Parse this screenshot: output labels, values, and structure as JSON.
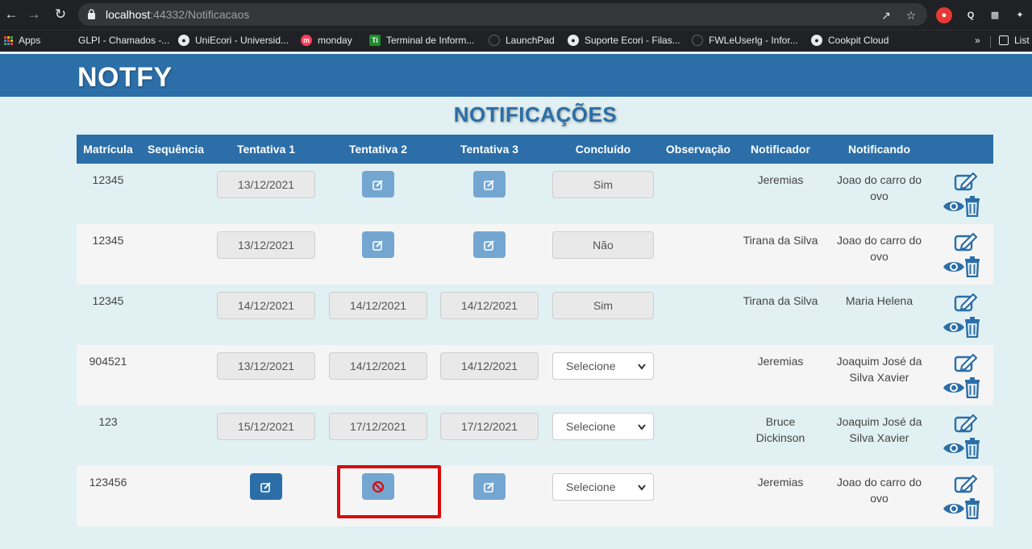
{
  "browser": {
    "url_host": "localhost",
    "url_rest": ":44332/Notificacaos",
    "bookmarks": [
      {
        "label": "Apps",
        "icon": "apps-grid-icon"
      },
      {
        "label": "GLPI - Chamados -...",
        "icon": "glpi-icon"
      },
      {
        "label": "UniEcori - Universid...",
        "icon": "globe-icon"
      },
      {
        "label": "monday",
        "icon": "monday-icon"
      },
      {
        "label": "Terminal de Inform...",
        "icon": "terminal-icon"
      },
      {
        "label": "LaunchPad",
        "icon": "launchpad-icon"
      },
      {
        "label": "Suporte Ecori - Filas...",
        "icon": "globe-icon"
      },
      {
        "label": "FWLeUserlg - Infor...",
        "icon": "fw-icon"
      },
      {
        "label": "Cookpit Cloud",
        "icon": "globe-icon"
      }
    ],
    "more_bookmarks": "»",
    "reading_list": "List"
  },
  "app": {
    "brand": "NOTFY",
    "page_title": "NOTIFICAÇÕES"
  },
  "table": {
    "headers": [
      "Matrícula",
      "Sequência",
      "Tentativa 1",
      "Tentativa 2",
      "Tentativa 3",
      "Concluído",
      "Observação",
      "Notificador",
      "Notificando"
    ],
    "rows": [
      {
        "matricula": "12345",
        "t1": "13/12/2021",
        "t2": null,
        "t3": null,
        "concluido": "Sim",
        "concluido_type": "text",
        "notificador": "Jeremias",
        "notificando": "Joao do carro do ovo"
      },
      {
        "matricula": "12345",
        "t1": "13/12/2021",
        "t2": null,
        "t3": null,
        "concluido": "Não",
        "concluido_type": "text",
        "notificador": "Tirana da Silva",
        "notificando": "Joao do carro do ovo"
      },
      {
        "matricula": "12345",
        "t1": "14/12/2021",
        "t2": "14/12/2021",
        "t3": "14/12/2021",
        "concluido": "Sim",
        "concluido_type": "text",
        "notificador": "Tirana da Silva",
        "notificando": "Maria Helena"
      },
      {
        "matricula": "904521",
        "t1": "13/12/2021",
        "t2": "14/12/2021",
        "t3": "14/12/2021",
        "concluido": "Selecione",
        "concluido_type": "select",
        "notificador": "Jeremias",
        "notificando": "Joaquim José da Silva Xavier"
      },
      {
        "matricula": "123",
        "t1": "15/12/2021",
        "t2": "17/12/2021",
        "t3": "17/12/2021",
        "concluido": "Selecione",
        "concluido_type": "select",
        "notificador": "Bruce Dickinson",
        "notificando": "Joaquim José da Silva Xavier"
      },
      {
        "matricula": "123456",
        "t1": null,
        "t2": null,
        "t3": null,
        "concluido": "Selecione",
        "concluido_type": "select",
        "notificador": "Jeremias",
        "notificando": "Joao do carro do ovo"
      }
    ]
  },
  "colors": {
    "primary": "#2b6ea8",
    "button_light": "#74a6d2",
    "page_bg": "#e1f1f3",
    "highlight": "#d80c0c"
  }
}
